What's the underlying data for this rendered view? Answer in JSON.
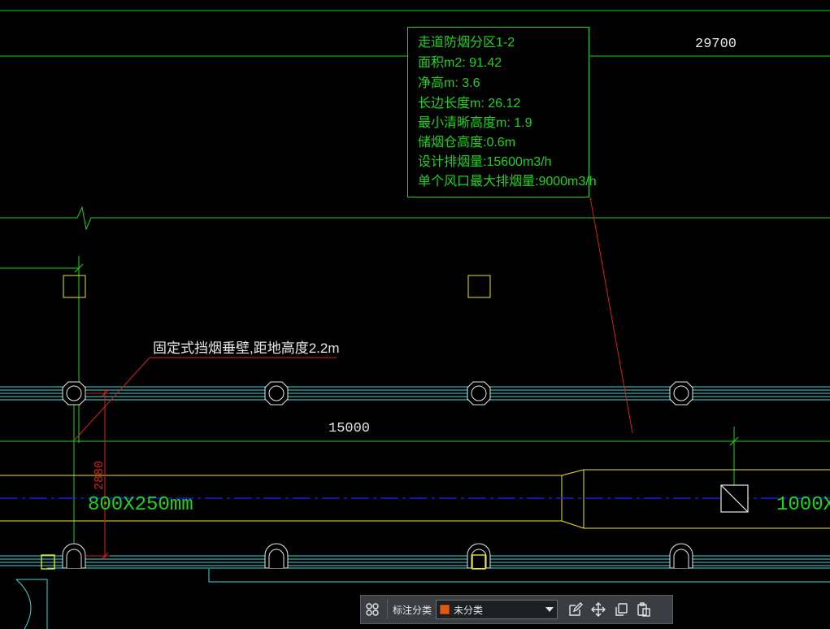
{
  "drawing": {
    "dim_top": "29700",
    "dim_mid": "15000",
    "dim_vertical": "2880",
    "duct_left_label": "800X250mm",
    "duct_right_label": "1000X",
    "wall_note": "固定式挡烟垂壁,距地高度2.2m"
  },
  "annotation": {
    "lines": [
      "走道防烟分区1-2",
      "面积m2: 91.42",
      "净高m: 3.6",
      "长边长度m: 26.12",
      "最小清晰高度m: 1.9",
      "储烟仓高度:0.6m",
      "设计排烟量:15600m3/h",
      "单个风口最大排烟量:9000m3/h"
    ]
  },
  "toolbar": {
    "category_label": "标注分类",
    "category_value": "未分类",
    "icons": [
      "grid-icon",
      "edit-icon",
      "move-icon",
      "copy-icon",
      "paste-icon"
    ]
  },
  "colors": {
    "background": "#000000",
    "green": "#1fd21f",
    "cyan": "#3fd6d6",
    "yellow": "#e6e62a",
    "red": "#d42020",
    "blue_center": "#2020ff",
    "white": "#e8e8e8"
  }
}
